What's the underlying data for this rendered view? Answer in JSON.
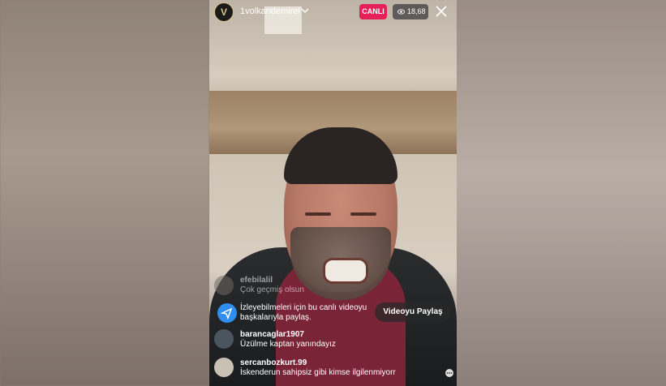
{
  "header": {
    "username": "1volkandemirel",
    "live_label": "CANLI",
    "viewer_count": "18,68"
  },
  "comments": [
    {
      "user": "efebilalil",
      "text": "Çok geçmiş olsun"
    },
    {
      "user": "",
      "text_line1": "İzleyebilmeleri için bu canlı videoyu",
      "text_line2": "başkalarıyla paylaş."
    },
    {
      "user": "barancaglar1907",
      "text": "Üzülme kaptan yanındayız"
    },
    {
      "user": "sercanbozkurt.99",
      "text": "İskenderun sahipsiz gibi kimse ilgilenmiyorr"
    }
  ],
  "share_button_label": "Videoyu Paylaş",
  "colors": {
    "live": "#e6215a",
    "share_icon": "#2e8ff0"
  }
}
